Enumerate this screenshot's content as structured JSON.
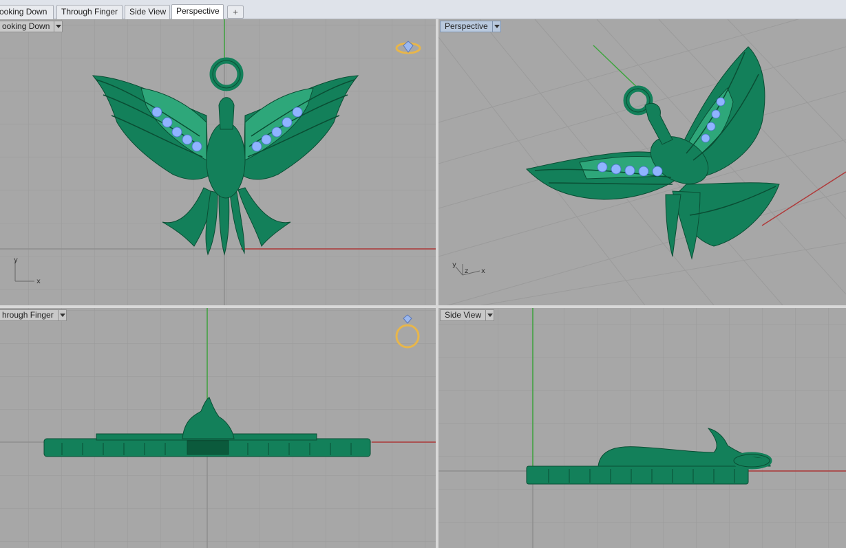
{
  "tabs": [
    {
      "label": "ooking Down",
      "active": false
    },
    {
      "label": "Through Finger",
      "active": false
    },
    {
      "label": "Side View",
      "active": false
    },
    {
      "label": "Perspective",
      "active": true
    }
  ],
  "tab_add_symbol": "+",
  "viewports": {
    "top_left": {
      "label": "ooking Down",
      "axis_labels": {
        "y": "y",
        "x": "x"
      }
    },
    "top_right": {
      "label": "Perspective",
      "axis_labels": {
        "y": "y",
        "z": "z",
        "x": "x"
      }
    },
    "bottom_left": {
      "label": "hrough Finger"
    },
    "bottom_right": {
      "label": "Side View"
    }
  },
  "colors": {
    "model_green": "#13805a",
    "model_dark": "#0b5a3c",
    "gem_blue": "#8fb4ff",
    "grid_bg": "#a6a6a6",
    "grid_line": "#999999",
    "axis_x": "#b03a3a",
    "axis_y": "#3fa53f",
    "gadget_gold": "#e8b64a",
    "active_label": "#b9c9de"
  },
  "icons": [
    "diamond-ring-icon",
    "ring-icon",
    "dropdown-arrow-icon",
    "add-tab-icon"
  ]
}
